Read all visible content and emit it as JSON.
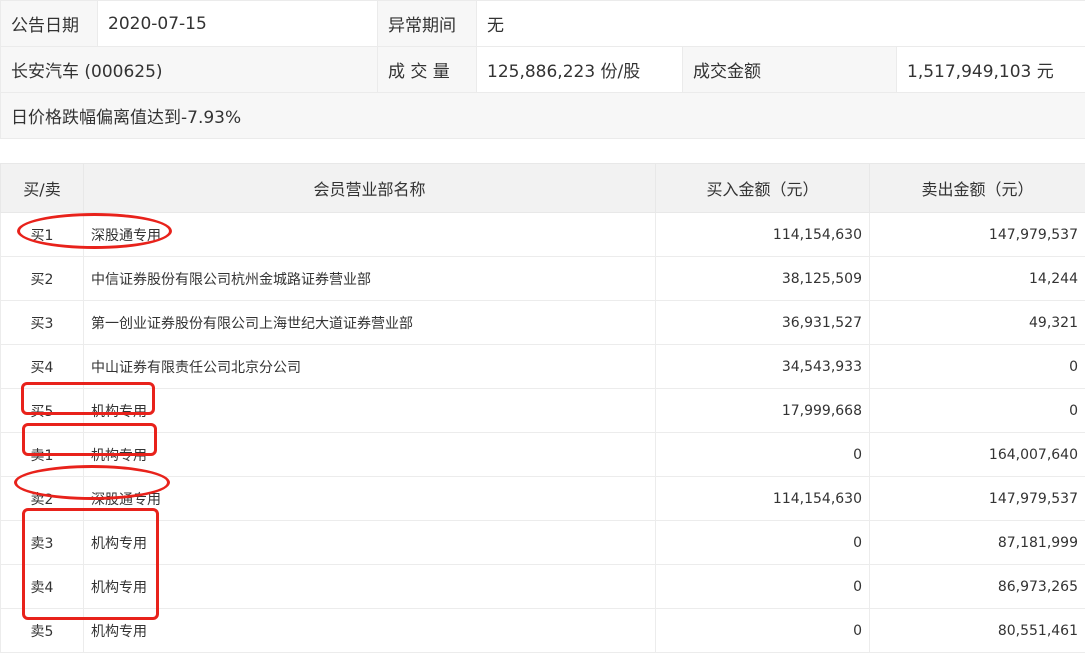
{
  "info": {
    "date_label": "公告日期",
    "date_value": "2020-07-15",
    "period_label": "异常期间",
    "period_value": "无",
    "stock_name": "长安汽车 (000625)",
    "volume_label": "成 交 量",
    "volume_value": "125,886,223 份/股",
    "amount_label": "成交金额",
    "amount_value": "1,517,949,103 元",
    "reason": "日价格跌幅偏离值达到-7.93%"
  },
  "table": {
    "headers": {
      "side": "买/卖",
      "member": "会员营业部名称",
      "buy": "买入金额（元）",
      "sell": "卖出金额（元）"
    },
    "rows": [
      {
        "side": "买1",
        "member": "深股通专用",
        "buy": "114,154,630",
        "sell": "147,979,537"
      },
      {
        "side": "买2",
        "member": "中信证券股份有限公司杭州金城路证券营业部",
        "buy": "38,125,509",
        "sell": "14,244"
      },
      {
        "side": "买3",
        "member": "第一创业证券股份有限公司上海世纪大道证券营业部",
        "buy": "36,931,527",
        "sell": "49,321"
      },
      {
        "side": "买4",
        "member": "中山证券有限责任公司北京分公司",
        "buy": "34,543,933",
        "sell": "0"
      },
      {
        "side": "买5",
        "member": "机构专用",
        "buy": "17,999,668",
        "sell": "0"
      },
      {
        "side": "卖1",
        "member": "机构专用",
        "buy": "0",
        "sell": "164,007,640"
      },
      {
        "side": "卖2",
        "member": "深股通专用",
        "buy": "114,154,630",
        "sell": "147,979,537"
      },
      {
        "side": "卖3",
        "member": "机构专用",
        "buy": "0",
        "sell": "87,181,999"
      },
      {
        "side": "卖4",
        "member": "机构专用",
        "buy": "0",
        "sell": "86,973,265"
      },
      {
        "side": "卖5",
        "member": "机构专用",
        "buy": "0",
        "sell": "80,551,461"
      }
    ]
  },
  "annotation_color": "#e8221b"
}
